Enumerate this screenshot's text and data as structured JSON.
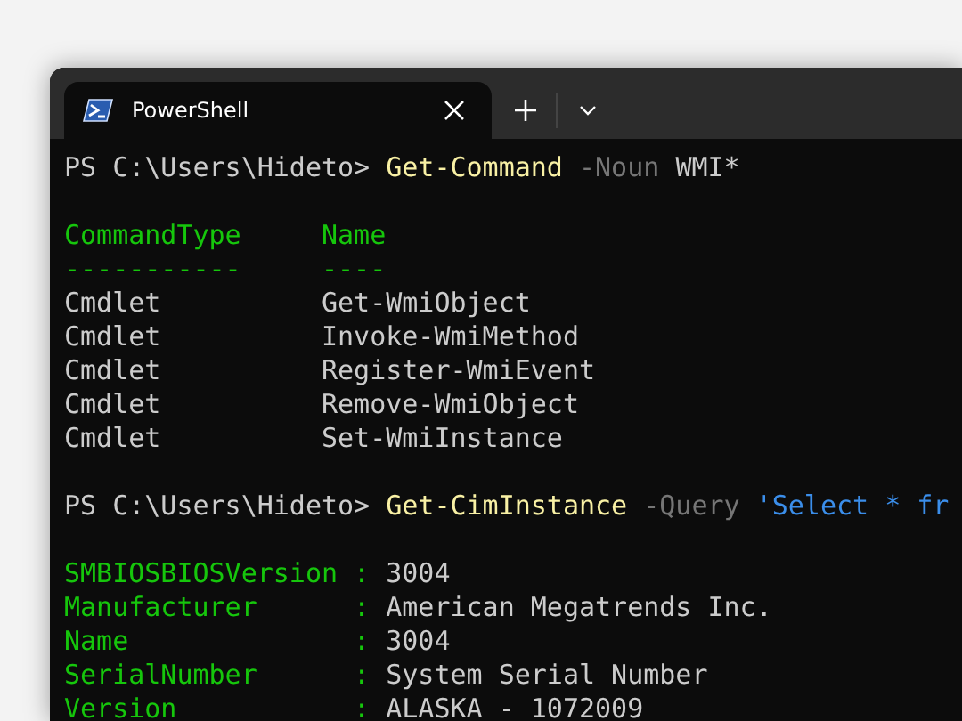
{
  "tab": {
    "title": "PowerShell",
    "selected": true
  },
  "lines": [
    {
      "kind": "prompt",
      "prompt": "PS C:\\Users\\Hideto>",
      "command": "Get-Command",
      "parameter": "-Noun",
      "argument": {
        "kind": "plain",
        "text": "WMI*"
      }
    },
    {
      "kind": "blank"
    },
    {
      "kind": "table_header",
      "cells": [
        "CommandType",
        "Name"
      ]
    },
    {
      "kind": "table_rule",
      "cells": [
        "-----------",
        "----"
      ]
    },
    {
      "kind": "table_row",
      "cells": [
        "Cmdlet",
        "Get-WmiObject"
      ]
    },
    {
      "kind": "table_row",
      "cells": [
        "Cmdlet",
        "Invoke-WmiMethod"
      ]
    },
    {
      "kind": "table_row",
      "cells": [
        "Cmdlet",
        "Register-WmiEvent"
      ]
    },
    {
      "kind": "table_row",
      "cells": [
        "Cmdlet",
        "Remove-WmiObject"
      ]
    },
    {
      "kind": "table_row",
      "cells": [
        "Cmdlet",
        "Set-WmiInstance"
      ]
    },
    {
      "kind": "blank"
    },
    {
      "kind": "prompt",
      "prompt": "PS C:\\Users\\Hideto>",
      "command": "Get-CimInstance",
      "parameter": "-Query",
      "argument": {
        "kind": "string",
        "text": "'Select * fr"
      }
    },
    {
      "kind": "blank"
    },
    {
      "kind": "property",
      "key": "SMBIOSBIOSVersion",
      "separator": ":",
      "value": "3004"
    },
    {
      "kind": "property",
      "key": "Manufacturer",
      "separator": ":",
      "value": "American Megatrends Inc."
    },
    {
      "kind": "property",
      "key": "Name",
      "separator": ":",
      "value": "3004"
    },
    {
      "kind": "property",
      "key": "SerialNumber",
      "separator": ":",
      "value": "System Serial Number"
    },
    {
      "kind": "property",
      "key": "Version",
      "separator": ":",
      "value": "ALASKA - 1072009"
    }
  ]
}
